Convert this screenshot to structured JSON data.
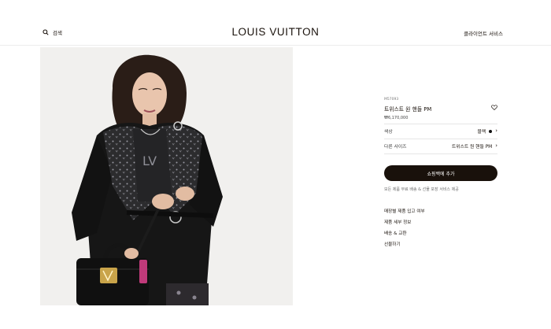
{
  "header": {
    "search_label": "검색",
    "logo_text": "LOUIS VUITTON",
    "client_service": "클라이언트 서비스"
  },
  "product": {
    "sku": "M57093",
    "name": "트위스트 원 핸들 PM",
    "price": "₩6,170,000",
    "image_alt": "Model in black coat holding black Twist One Handle bag"
  },
  "options": {
    "color_label": "색상",
    "color_value": "블랙",
    "color_swatch": "#111111",
    "size_label": "다른 사이즈",
    "size_value": "트위스트 원 핸들 PM"
  },
  "actions": {
    "add_to_cart": "쇼핑백에 추가",
    "free_shipping": "모든 제품 무료 배송 & 선물 포장 서비스 제공"
  },
  "links": [
    "매장별 제품 입고 여부",
    "제품 세부 정보",
    "배송 & 교환",
    "선물하기"
  ],
  "colors": {
    "brand_dark": "#19110b",
    "image_bg": "#f1f0ee"
  }
}
